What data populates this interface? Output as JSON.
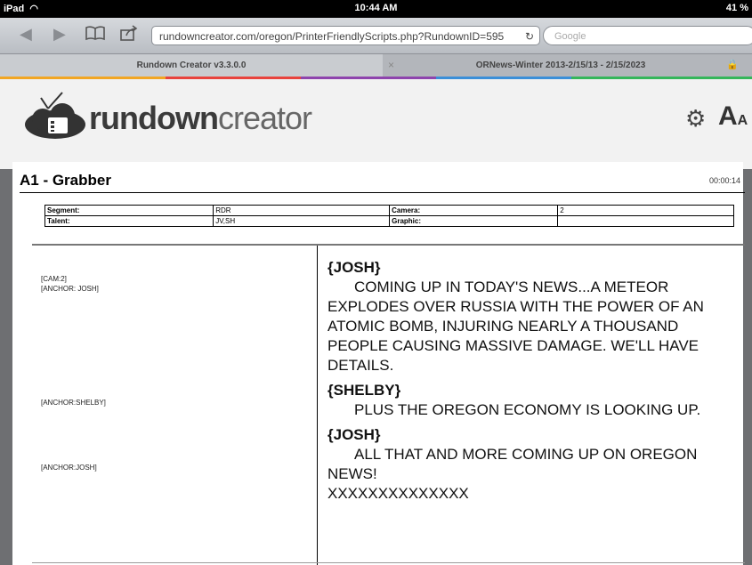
{
  "status_bar": {
    "device": "iPad",
    "time": "10:44 AM",
    "battery": "41 %"
  },
  "browser": {
    "url": "rundowncreator.com/oregon/PrinterFriendlyScripts.php?RundownID=595",
    "search_placeholder": "Google",
    "tabs": [
      {
        "label": "Rundown Creator v3.3.0.0"
      },
      {
        "label": "ORNews-Winter 2013-2/15/13 - 2/15/2023"
      }
    ]
  },
  "logo": {
    "bold": "rundown",
    "light": "creator"
  },
  "font_control": {
    "large": "A",
    "small": "A"
  },
  "story": {
    "title": "A1 - Grabber",
    "duration": "00:00:14",
    "info": {
      "segment_label": "Segment:",
      "segment_value": "RDR",
      "camera_label": "Camera:",
      "camera_value": "2",
      "talent_label": "Talent:",
      "talent_value": "JV,SH",
      "graphic_label": "Graphic:",
      "graphic_value": ""
    }
  },
  "cues": [
    {
      "lines": [
        "[CAM:2]",
        "[ANCHOR: JOSH]"
      ]
    },
    {
      "lines": [
        "[ANCHOR:SHELBY]"
      ]
    },
    {
      "lines": [
        "[ANCHOR:JOSH]"
      ]
    }
  ],
  "script": [
    {
      "speaker": "{JOSH}",
      "text": "COMING UP IN TODAY'S NEWS...A METEOR EXPLODES OVER RUSSIA WITH THE POWER OF AN ATOMIC BOMB, INJURING NEARLY A THOUSAND PEOPLE CAUSING MASSIVE DAMAGE. WE'LL HAVE DETAILS."
    },
    {
      "speaker": "{SHELBY}",
      "text": "PLUS THE OREGON ECONOMY IS LOOKING UP."
    },
    {
      "speaker": "{JOSH}",
      "text": "ALL THAT AND MORE COMING UP ON OREGON NEWS!"
    }
  ],
  "script_end": "XXXXXXXXXXXXXX"
}
